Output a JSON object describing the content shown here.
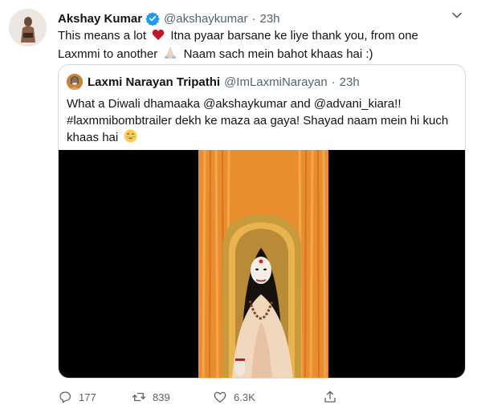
{
  "author": {
    "name": "Akshay Kumar",
    "handle": "@akshaykumar",
    "separator": "·",
    "time": "23h"
  },
  "tweet": {
    "text_part1": "This means a lot",
    "text_part2": "Itna pyaar barsane ke liye thank you, from one Laxmmi to another",
    "text_part3": "Naam sach mein bahot khaas hai :)"
  },
  "quoted": {
    "name": "Laxmi Narayan Tripathi",
    "handle": "@ImLaxmiNarayan",
    "separator": "·",
    "time": "23h",
    "text": "What a Diwali dhamaaka @akshaykumar and @advani_kiara!! #laxmmibombtrailer dekh ke maza aa gaya! Shayad naam mein hi kuch khaas hai"
  },
  "actions": {
    "replies": "177",
    "retweets": "839",
    "likes": "6.3K"
  },
  "colors": {
    "text": "#0f1419",
    "secondary": "#536471",
    "border": "#cfd9de",
    "verified": "#1d9bf0",
    "heart_emoji": "#c0182d",
    "curtain": "#e98d2f",
    "throne": "#c79a3c",
    "robe": "#f2d7bf"
  },
  "icons": [
    "verified-badge-icon",
    "chevron-down-icon",
    "red-heart-emoji",
    "folded-hands-emoji",
    "grinning-emoji",
    "reply-icon",
    "retweet-icon",
    "like-icon",
    "share-icon"
  ]
}
